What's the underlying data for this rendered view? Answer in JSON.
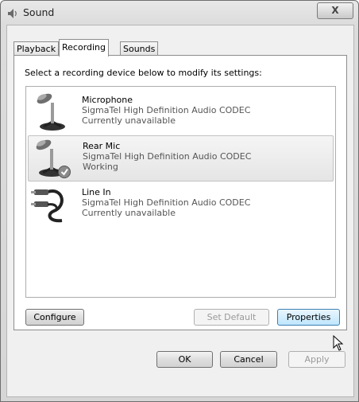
{
  "window": {
    "title": "Sound",
    "close_label": "X"
  },
  "tabs": [
    {
      "label": "Playback",
      "active": false
    },
    {
      "label": "Recording",
      "active": true
    },
    {
      "label": "Sounds",
      "active": false
    }
  ],
  "panel": {
    "instruction": "Select a recording device below to modify its settings:"
  },
  "devices": [
    {
      "name": "Microphone",
      "driver": "SigmaTel High Definition Audio CODEC",
      "status": "Currently unavailable",
      "icon": "microphone-icon",
      "selected": false
    },
    {
      "name": "Rear Mic",
      "driver": "SigmaTel High Definition Audio CODEC",
      "status": "Working",
      "icon": "microphone-icon",
      "selected": true,
      "default": true
    },
    {
      "name": "Line In",
      "driver": "SigmaTel High Definition Audio CODEC",
      "status": "Currently unavailable",
      "icon": "audio-cable-icon",
      "selected": false
    }
  ],
  "panel_buttons": {
    "configure": "Configure",
    "set_default": "Set Default",
    "properties": "Properties"
  },
  "dialog_buttons": {
    "ok": "OK",
    "cancel": "Cancel",
    "apply": "Apply"
  }
}
